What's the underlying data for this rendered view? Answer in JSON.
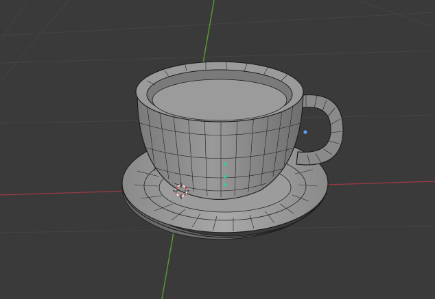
{
  "app": {
    "context": "3D viewport",
    "object": "teacup-with-saucer",
    "display_mode": "wireframe-on-solid"
  },
  "colors": {
    "background": "#3a3a3a",
    "grid_line": "#454545",
    "x_axis": "#a03a45",
    "y_axis": "#57a02d",
    "mesh_face": "#8e8e8e",
    "mesh_face_light": "#a9a9a9",
    "mesh_face_dark": "#6f6f6f",
    "wire": "#1e1e1e",
    "selected_vertex": "#2fd09a",
    "vertex_highlight": "#5aa0ff",
    "cursor_red": "#d33",
    "cursor_white": "#ffffff"
  },
  "cursor_3d": {
    "icon": "3d-cursor-icon"
  },
  "selection": {
    "selected_vertex_count_shown": 4
  }
}
